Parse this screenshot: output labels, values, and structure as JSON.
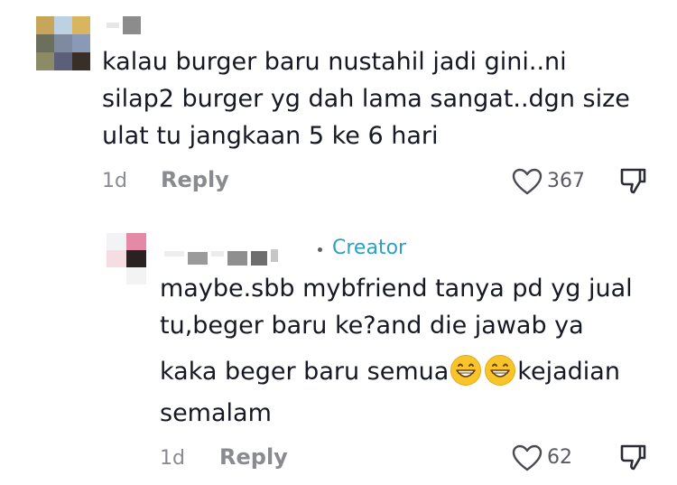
{
  "comment": {
    "lines": [
      "kalau burger baru nustahil jadi gini..ni",
      "silap2 burger yg dah lama sangat..dgn size",
      "ulat tu jangkaan 5 ke 6 hari"
    ],
    "date": "1d",
    "reply_label": "Reply",
    "like_count": "367",
    "avatar_colors": [
      "#c7a55a",
      "#bcd2e3",
      "#d8b660",
      "#6c6f5b",
      "#7e8aa0",
      "#8a9ab6",
      "#8d8a67",
      "#5c5f7a",
      "#3a2e28"
    ]
  },
  "reply": {
    "creator_label": "Creator",
    "text_line_1": "maybe.sbb mybfriend tanya pd yg jual",
    "text_line_2": "tu,beger baru ke?and die jawab ya",
    "text_line_3_before": "kaka beger baru semua",
    "text_line_3_after": "kejadian",
    "text_line_4": "semalam",
    "date": "1d",
    "reply_label": "Reply",
    "like_count": "62",
    "avatar_colors": [
      "#f3f3f5",
      "#e48aa6",
      "#f6dde3",
      "#2a2222",
      "#ffffff",
      "#f3f3f3"
    ],
    "emoji": [
      "grinning-face",
      "grinning-face"
    ]
  }
}
